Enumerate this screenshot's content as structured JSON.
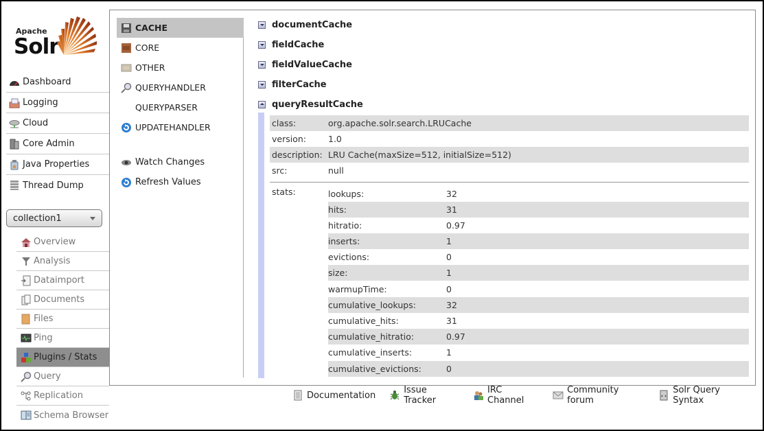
{
  "logo": {
    "apache": "Apache",
    "solr": "Solr"
  },
  "menu": [
    {
      "label": "Dashboard",
      "icon": "dashboard-icon"
    },
    {
      "label": "Logging",
      "icon": "logging-icon"
    },
    {
      "label": "Cloud",
      "icon": "cloud-icon"
    },
    {
      "label": "Core Admin",
      "icon": "core-admin-icon"
    },
    {
      "label": "Java Properties",
      "icon": "java-properties-icon"
    },
    {
      "label": "Thread Dump",
      "icon": "thread-dump-icon"
    }
  ],
  "collection_select": {
    "value": "collection1"
  },
  "core_menu": [
    {
      "label": "Overview",
      "icon": "overview-icon",
      "active": false
    },
    {
      "label": "Analysis",
      "icon": "analysis-icon",
      "active": false
    },
    {
      "label": "Dataimport",
      "icon": "dataimport-icon",
      "active": false
    },
    {
      "label": "Documents",
      "icon": "documents-icon",
      "active": false
    },
    {
      "label": "Files",
      "icon": "files-icon",
      "active": false
    },
    {
      "label": "Ping",
      "icon": "ping-icon",
      "active": false
    },
    {
      "label": "Plugins / Stats",
      "icon": "plugins-icon",
      "active": true
    },
    {
      "label": "Query",
      "icon": "query-icon",
      "active": false
    },
    {
      "label": "Replication",
      "icon": "replication-icon",
      "active": false
    },
    {
      "label": "Schema Browser",
      "icon": "schema-browser-icon",
      "active": false
    }
  ],
  "plugin_types": [
    {
      "label": "CACHE",
      "icon": "cache-icon",
      "active": true
    },
    {
      "label": "CORE",
      "icon": "core-icon",
      "active": false
    },
    {
      "label": "OTHER",
      "icon": "other-icon",
      "active": false
    },
    {
      "label": "QUERYHANDLER",
      "icon": "queryhandler-icon",
      "active": false
    },
    {
      "label": "QUERYPARSER",
      "icon": "",
      "active": false
    },
    {
      "label": "UPDATEHANDLER",
      "icon": "updatehandler-icon",
      "active": false
    }
  ],
  "actions": {
    "watch_changes": "Watch Changes",
    "refresh_values": "Refresh Values"
  },
  "caches": [
    {
      "name": "documentCache",
      "expanded": false
    },
    {
      "name": "fieldCache",
      "expanded": false
    },
    {
      "name": "fieldValueCache",
      "expanded": false
    },
    {
      "name": "filterCache",
      "expanded": false
    },
    {
      "name": "queryResultCache",
      "expanded": true
    }
  ],
  "detail": {
    "properties": [
      {
        "key": "class:",
        "value": "org.apache.solr.search.LRUCache"
      },
      {
        "key": "version:",
        "value": "1.0"
      },
      {
        "key": "description:",
        "value": "LRU Cache(maxSize=512, initialSize=512)"
      },
      {
        "key": "src:",
        "value": "null"
      }
    ],
    "stats_label": "stats:",
    "stats": [
      {
        "key": "lookups:",
        "value": "32"
      },
      {
        "key": "hits:",
        "value": "31"
      },
      {
        "key": "hitratio:",
        "value": "0.97"
      },
      {
        "key": "inserts:",
        "value": "1"
      },
      {
        "key": "evictions:",
        "value": "0"
      },
      {
        "key": "size:",
        "value": "1"
      },
      {
        "key": "warmupTime:",
        "value": "0"
      },
      {
        "key": "cumulative_lookups:",
        "value": "32"
      },
      {
        "key": "cumulative_hits:",
        "value": "31"
      },
      {
        "key": "cumulative_hitratio:",
        "value": "0.97"
      },
      {
        "key": "cumulative_inserts:",
        "value": "1"
      },
      {
        "key": "cumulative_evictions:",
        "value": "0"
      }
    ]
  },
  "footer": [
    {
      "label": "Documentation",
      "icon": "documentation-icon"
    },
    {
      "label": "Issue Tracker",
      "icon": "bug-icon"
    },
    {
      "label": "IRC Channel",
      "icon": "irc-users-icon"
    },
    {
      "label": "Community forum",
      "icon": "mail-icon"
    },
    {
      "label": "Solr Query Syntax",
      "icon": "query-syntax-icon"
    }
  ],
  "colors": {
    "active_core_item": "#8e8e8e",
    "active_type_item": "#c4c4c4",
    "row_shade": "#dedede",
    "detail_bar": "#c8cdf8"
  }
}
